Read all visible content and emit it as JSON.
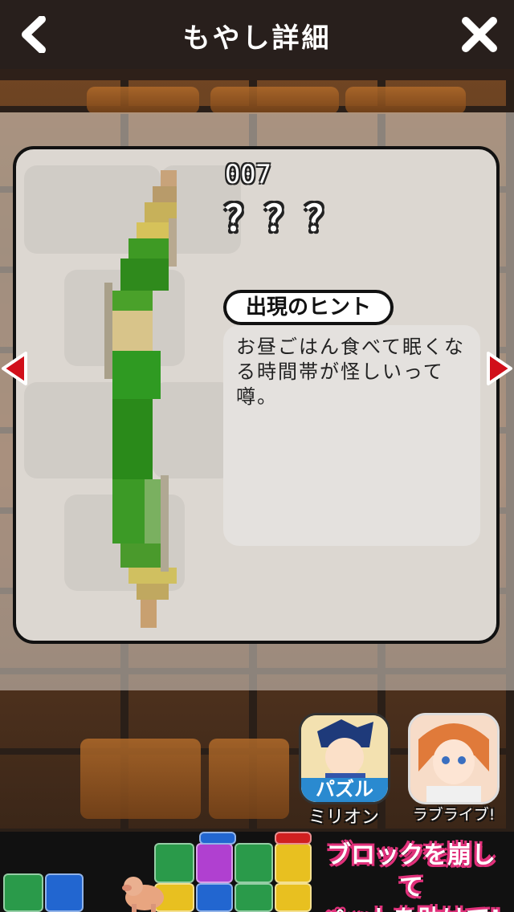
{
  "header": {
    "title": "もやし詳細"
  },
  "item": {
    "number": "007",
    "name": "？？？",
    "hint_label": "出現のヒント",
    "hint_text": "お昼ごはん食べて眠くなる時間帯が怪しいって噂。"
  },
  "promos": [
    {
      "label": "ミリオン",
      "banner_text": "パズル"
    },
    {
      "label": "ラブライブ!"
    }
  ],
  "ad": {
    "text_line1": "ブロックを崩して",
    "text_line2": "ペットを助けて!"
  },
  "colors": {
    "header_bg": "#28201c",
    "card_bg": "#dcd7d1",
    "nav_arrow": "#d10f1a",
    "ad_accent": "#e0307a"
  },
  "icons": [
    "back-arrow-icon",
    "close-icon",
    "prev-arrow-icon",
    "next-arrow-icon"
  ]
}
